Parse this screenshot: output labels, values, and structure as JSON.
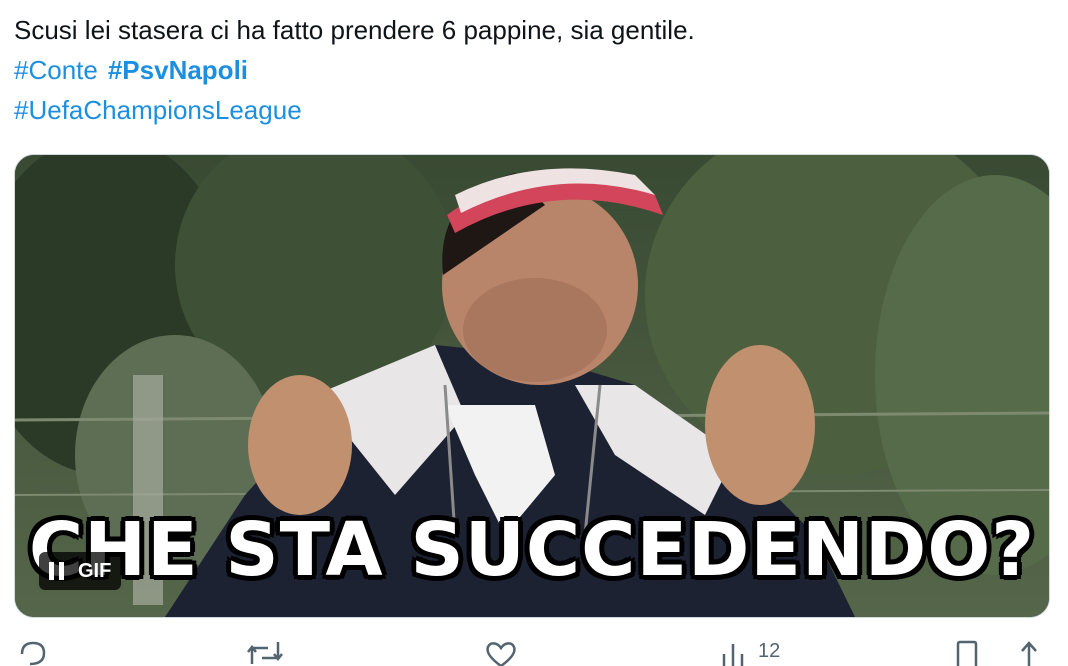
{
  "tweet": {
    "text": "Scusi lei stasera ci ha fatto prendere 6 pappine, sia gentile.",
    "hashtags": [
      "#Conte",
      "#PsvNapoli",
      "#UefaChampionsLeague"
    ]
  },
  "media": {
    "caption": "CHE STA SUCCEDENDO?",
    "gif_badge": "GIF"
  },
  "actions": {
    "views_count": "12"
  },
  "colors": {
    "hashtag": "#1d8fe0",
    "text": "#0f1419",
    "muted": "#536471"
  }
}
